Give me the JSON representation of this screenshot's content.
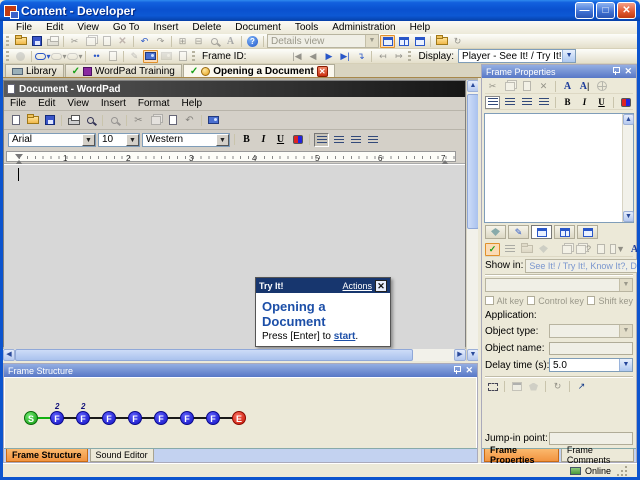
{
  "window": {
    "title": "Content - Developer"
  },
  "menubar": {
    "items": [
      "File",
      "Edit",
      "View",
      "Go To",
      "Insert",
      "Delete",
      "Document",
      "Tools",
      "Administration",
      "Help"
    ]
  },
  "toolbar": {
    "details_view": "Details view",
    "frame_id_label": "Frame ID:",
    "display_label": "Display:",
    "display_value": "Player - See It! / Try It!"
  },
  "doc_tabs": {
    "library": "Library",
    "module": "WordPad Training",
    "topic": "Opening a Document"
  },
  "wordpad": {
    "title": "Document - WordPad",
    "menu": [
      "File",
      "Edit",
      "View",
      "Insert",
      "Format",
      "Help"
    ],
    "font_name": "Arial",
    "font_size": "10",
    "charset": "Western",
    "bold": "B",
    "italic": "I",
    "underline": "U",
    "ruler": [
      "1",
      "2",
      "3",
      "4",
      "5",
      "6",
      "7"
    ]
  },
  "tryit": {
    "title": "Try It!",
    "actions_link": "Actions",
    "heading": "Opening a Document",
    "press_text": "Press [Enter] to ",
    "start_link": "start",
    "period": "."
  },
  "frame_structure": {
    "title": "Frame Structure",
    "nodes": [
      {
        "label": "S",
        "badge": ""
      },
      {
        "label": "F",
        "badge": "2"
      },
      {
        "label": "F",
        "badge": "2"
      },
      {
        "label": "F",
        "badge": ""
      },
      {
        "label": "F",
        "badge": ""
      },
      {
        "label": "F",
        "badge": ""
      },
      {
        "label": "F",
        "badge": ""
      },
      {
        "label": "F",
        "badge": ""
      },
      {
        "label": "E",
        "badge": ""
      }
    ],
    "tab_active": "Frame Structure",
    "tab_inactive": "Sound Editor"
  },
  "frame_props": {
    "title": "Frame Properties",
    "bold": "B",
    "italic": "I",
    "underline": "U",
    "show_in_label": "Show in:",
    "show_in_value": "See It! / Try It!, Know It?, Do It!",
    "alt_key": "Alt key",
    "control_key": "Control key",
    "shift_key": "Shift key",
    "application_label": "Application:",
    "object_type_label": "Object type:",
    "object_name_label": "Object name:",
    "delay_label": "Delay time (s):",
    "delay_value": "5.0",
    "jump_in_label": "Jump-in point:",
    "tab_active": "Frame Properties",
    "tab_inactive": "Frame Comments"
  },
  "statusbar": {
    "online": "Online"
  }
}
